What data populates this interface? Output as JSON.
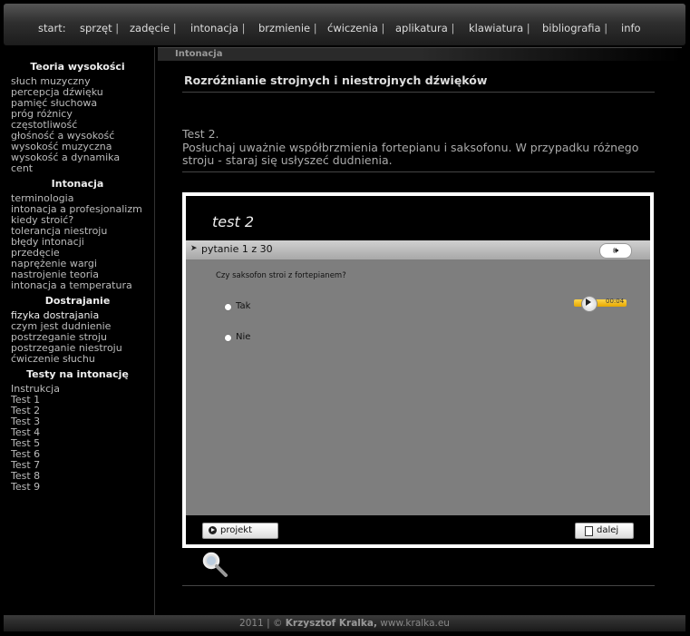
{
  "nav": {
    "start": "start:",
    "items": [
      "sprzęt",
      "zadęcie",
      "intonacja",
      "brzmienie",
      "ćwiczenia",
      "aplikatura",
      "klawiatura",
      "bibliografia",
      "info"
    ]
  },
  "section": "Intonacja",
  "sidebar": {
    "groups": [
      {
        "title": "Teoria wysokości",
        "items": [
          "słuch muzyczny",
          "percepcja dźwięku",
          "pamięć słuchowa",
          "próg różnicy",
          "częstotliwość",
          "głośność a wysokość",
          "wysokość muzyczna",
          "wysokość a dynamika",
          "cent"
        ]
      },
      {
        "title": "Intonacja",
        "items": [
          "terminologia",
          "intonacja a profesjonalizm",
          "kiedy stroić?",
          "tolerancja niestroju",
          "błędy intonacji",
          "przedęcie",
          "naprężenie wargi",
          "nastrojenie teoria",
          "intonacja a temperatura"
        ]
      },
      {
        "title": "Dostrajanie",
        "items": [
          "fizyka dostrajania",
          "czym jest dudnienie",
          "postrzeganie stroju",
          "postrzeganie niestroju",
          "ćwiczenie słuchu"
        ]
      },
      {
        "title": "Testy na intonację",
        "items": [
          "Instrukcja",
          "Test 1",
          "Test 2",
          "Test 3",
          "Test 4",
          "Test 5",
          "Test 6",
          "Test 7",
          "Test 8",
          "Test 9"
        ]
      }
    ]
  },
  "content": {
    "title": "Rozróżnianie strojnych i niestrojnych dźwięków",
    "test_heading": "Test 2.",
    "test_text": "Posłuchaj uważnie współbrzmienia fortepianu i saksofonu. W przypadku różnego stroju - staraj się usłyszeć dudnienia."
  },
  "player": {
    "title": "test 2",
    "progress": "pytanie 1 z 30",
    "question": "Czy saksofon stroi z fortepianem?",
    "options": [
      "Tak",
      "Nie"
    ],
    "audio_time": "00:04",
    "project_button": "projekt",
    "next_button": "dalej"
  },
  "footer": {
    "year": "2011 | ©",
    "author": "Krzysztof Kralka,",
    "site": "www.kralka.eu"
  }
}
